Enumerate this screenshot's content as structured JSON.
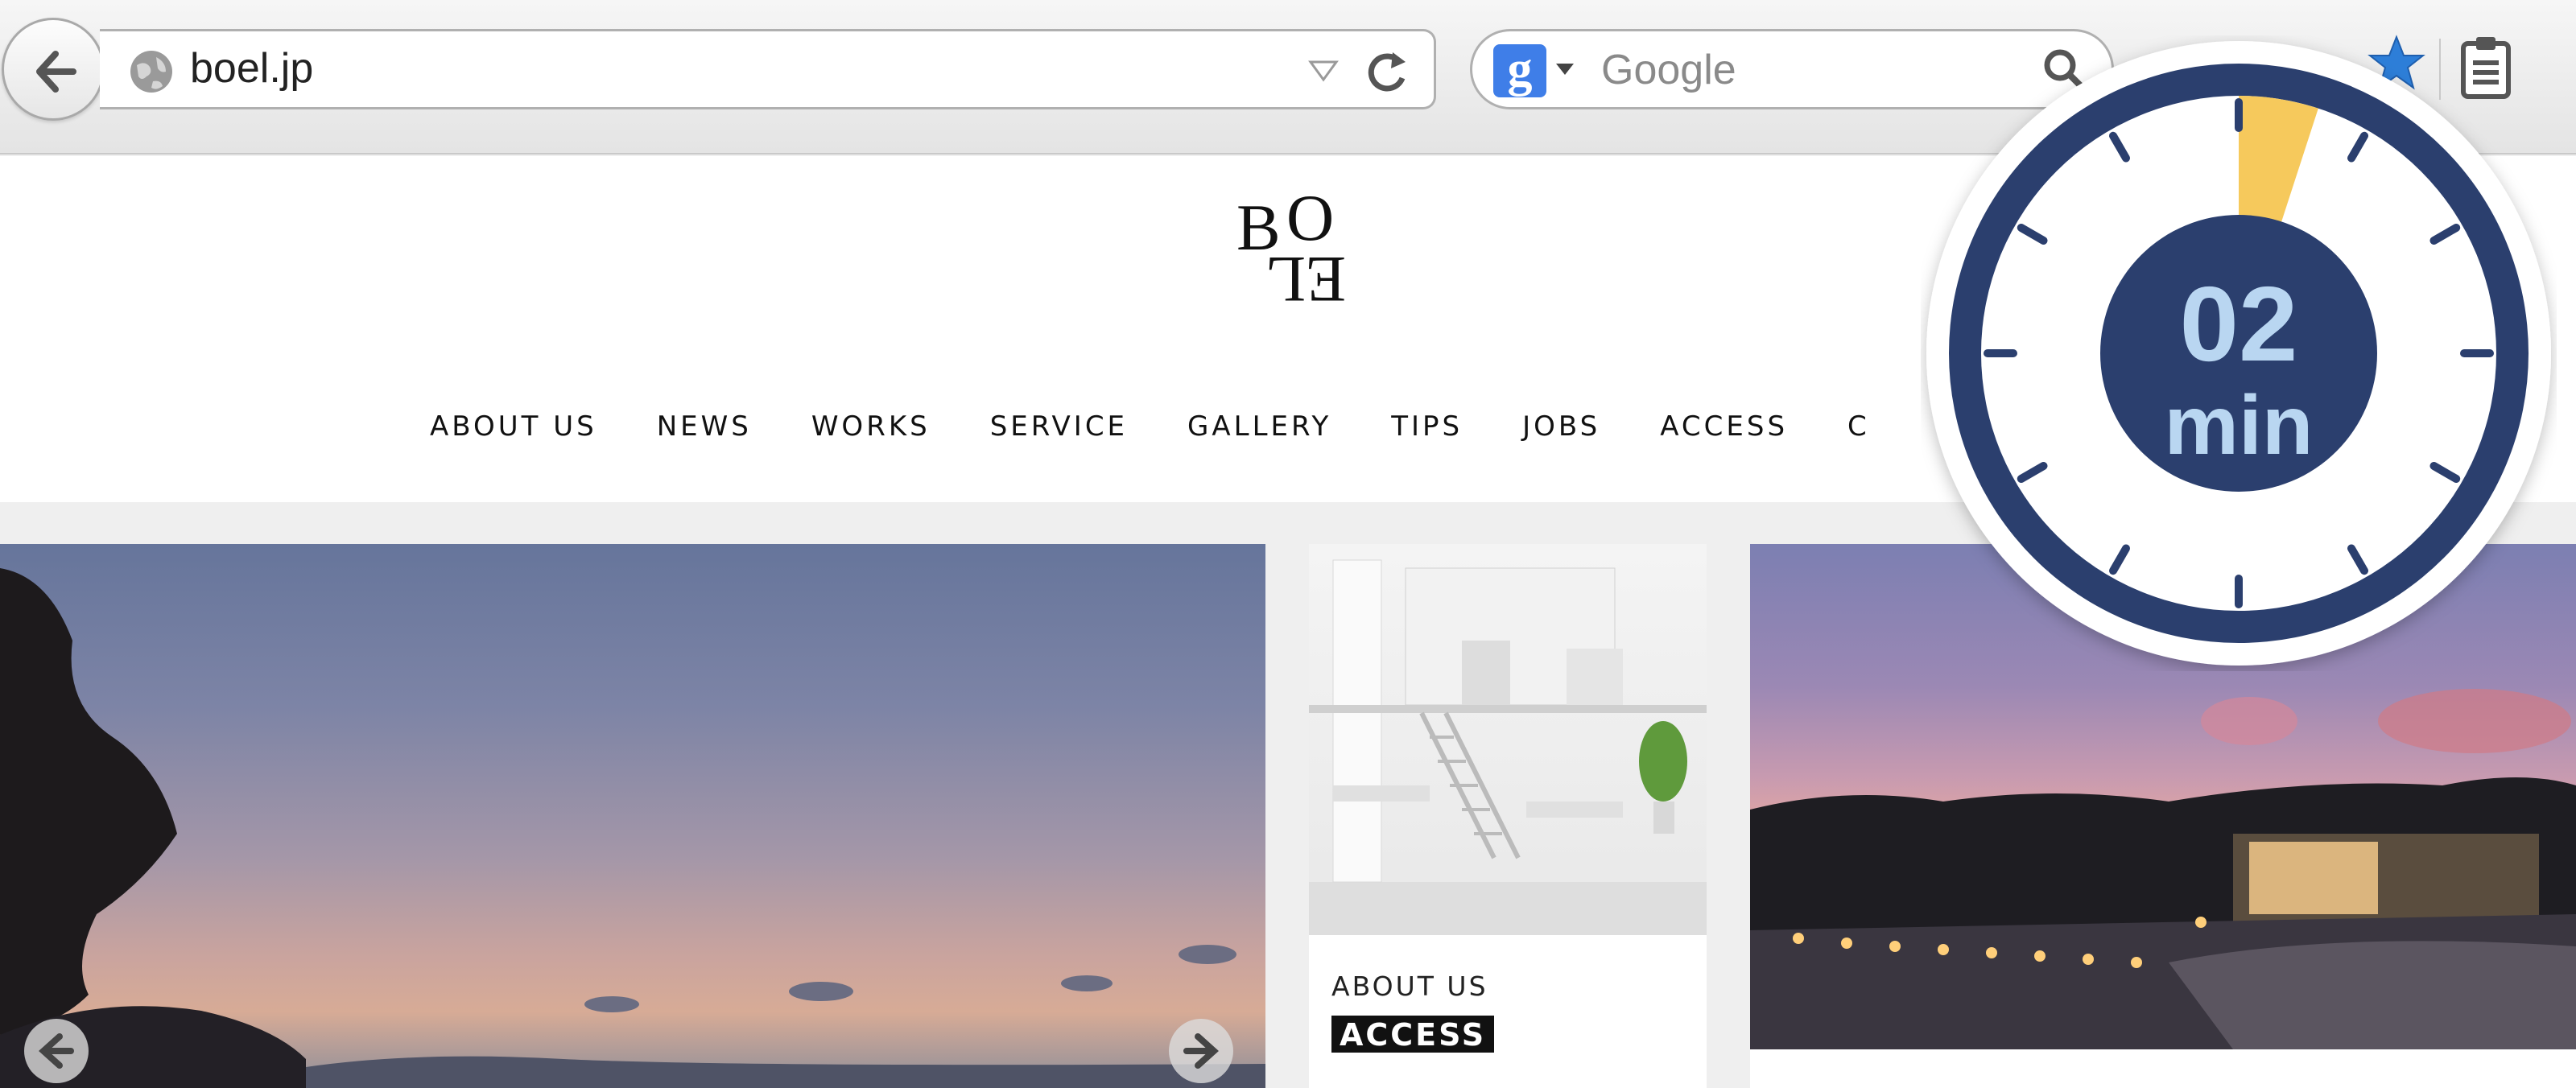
{
  "browser": {
    "url": "boel.jp",
    "search_placeholder": "Google",
    "search_engine_icon": "google-g",
    "icons": {
      "back": "back-arrow-icon",
      "globe": "globe-icon",
      "url_dropdown": "triangle-down-icon",
      "reload": "reload-icon",
      "search": "magnifier-icon",
      "bookmark": "star-icon",
      "clipboard": "clipboard-icon"
    }
  },
  "site": {
    "logo_text": "BOEL",
    "nav": [
      "ABOUT US",
      "NEWS",
      "WORKS",
      "SERVICE",
      "GALLERY",
      "TIPS",
      "JOBS",
      "ACCESS",
      "C"
    ]
  },
  "card": {
    "label": "ABOUT US",
    "tag": "ACCESS"
  },
  "timer": {
    "value": "02",
    "unit": "min",
    "colors": {
      "ring": "#2b3f6e",
      "face": "#ffffff",
      "wedge": "#f6c95c",
      "center": "#2b3f6e",
      "text": "#b9d6f1"
    }
  },
  "colors": {
    "accent_blue": "#3f7ee8",
    "bookmark_star": "#2d7ed8",
    "tag_bg": "#111111"
  }
}
